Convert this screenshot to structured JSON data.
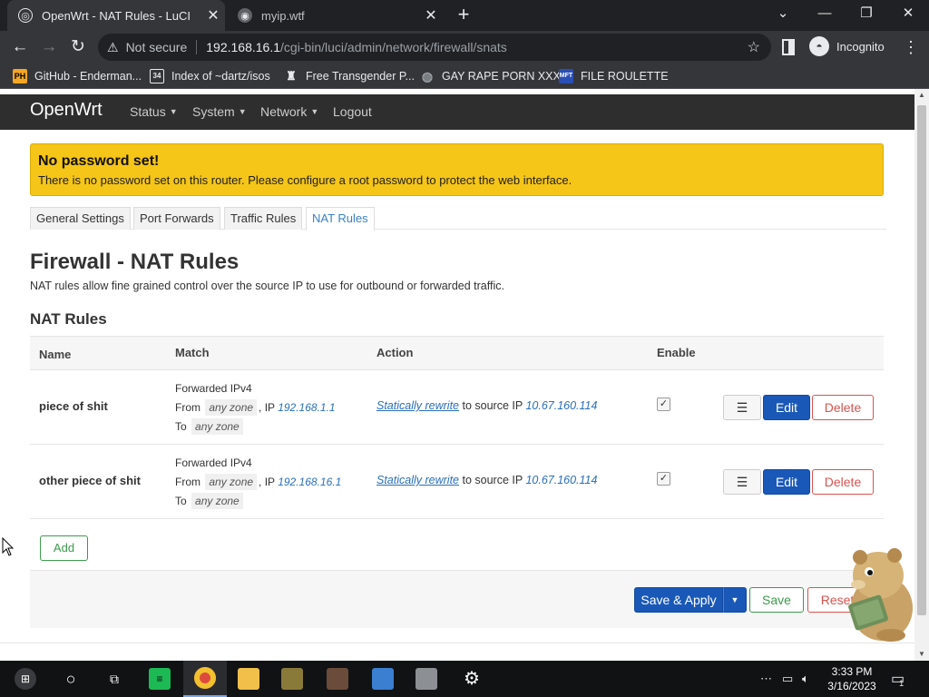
{
  "browser": {
    "tabs": [
      {
        "title": "OpenWrt - NAT Rules - LuCI",
        "active": true
      },
      {
        "title": "myip.wtf",
        "active": false
      }
    ],
    "url_host": "192.168.16.1",
    "url_path": "/cgi-bin/luci/admin/network/firewall/snats",
    "security_label": "Not secure",
    "profile_label": "Incognito",
    "bookmarks": [
      {
        "label": "GitHub - Enderman...",
        "icon": "PH",
        "color": "#f5a623"
      },
      {
        "label": "Index of ~dartz/isos",
        "icon": "34",
        "color": "#e8eaed"
      },
      {
        "label": "Free Transgender P...",
        "icon": "seal-icon",
        "color": "#e8eaed"
      },
      {
        "label": "GAY RAPE PORN XXX",
        "icon": "globe-icon",
        "color": "#9aa0a6"
      },
      {
        "label": "FILE ROULETTE",
        "icon": "MFT",
        "color": "#2a4fb5"
      }
    ]
  },
  "luci": {
    "brand": "OpenWrt",
    "menu": [
      {
        "label": "Status",
        "dropdown": true
      },
      {
        "label": "System",
        "dropdown": true
      },
      {
        "label": "Network",
        "dropdown": true
      },
      {
        "label": "Logout",
        "dropdown": false
      }
    ],
    "alert": {
      "title": "No password set!",
      "message": "There is no password set on this router. Please configure a root password to protect the web interface."
    },
    "tabs": [
      {
        "label": "General Settings",
        "active": false
      },
      {
        "label": "Port Forwards",
        "active": false
      },
      {
        "label": "Traffic Rules",
        "active": false
      },
      {
        "label": "NAT Rules",
        "active": true
      }
    ],
    "page_title": "Firewall - NAT Rules",
    "page_description": "NAT rules allow fine grained control over the source IP to use for outbound or forwarded traffic.",
    "section_title": "NAT Rules",
    "columns": [
      "Name",
      "Match",
      "Action",
      "Enable"
    ],
    "rules": [
      {
        "name": "piece of shit",
        "match_type": "Forwarded IPv4",
        "from_prefix": "From",
        "from_zone": "any zone",
        "ip_prefix": ", IP",
        "from_ip": "192.168.1.1",
        "to_prefix": "To",
        "to_zone": "any zone",
        "action_link": "Statically rewrite",
        "action_text": "to source IP",
        "rewrite_ip": "10.67.160.114",
        "enabled": true,
        "drag_label": "☰",
        "edit_label": "Edit",
        "delete_label": "Delete"
      },
      {
        "name": "other piece of shit",
        "match_type": "Forwarded IPv4",
        "from_prefix": "From",
        "from_zone": "any zone",
        "ip_prefix": ", IP",
        "from_ip": "192.168.16.1",
        "to_prefix": "To",
        "to_zone": "any zone",
        "action_link": "Statically rewrite",
        "action_text": "to source IP",
        "rewrite_ip": "10.67.160.114",
        "enabled": true,
        "drag_label": "☰",
        "edit_label": "Edit",
        "delete_label": "Delete"
      }
    ],
    "add_label": "Add",
    "save_apply_label": "Save & Apply",
    "save_label": "Save",
    "reset_label": "Reset"
  },
  "taskbar": {
    "time": "3:33 PM",
    "date": "3/16/2023",
    "notification_count": "1",
    "apps": [
      "start-button",
      "cortana-button",
      "task-view-button",
      "spotify-icon",
      "chrome-icon",
      "file-explorer-icon",
      "game-icon",
      "app-icon",
      "app-icon",
      "vmware-icon",
      "settings-icon"
    ]
  },
  "colors": {
    "alert_bg": "#f5c518",
    "header_bg": "#2e2e2e",
    "primary": "#1a58b8",
    "positive": "#3d9a4d",
    "negative": "#d9534f",
    "link": "#2a6ebb"
  }
}
